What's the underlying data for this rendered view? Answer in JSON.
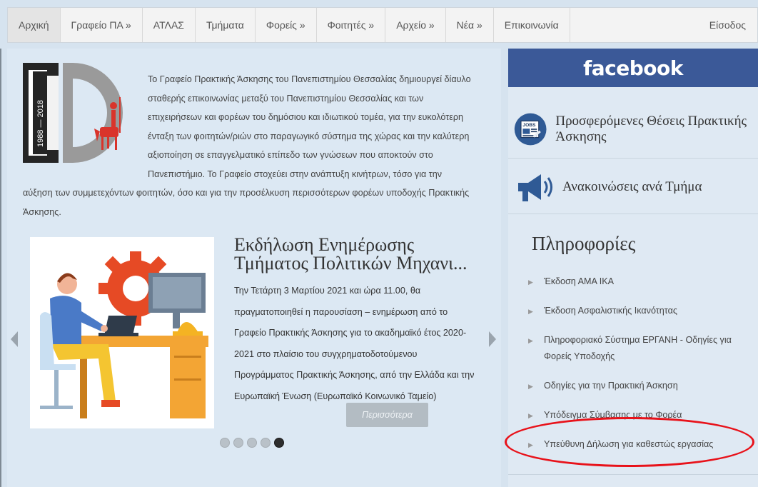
{
  "nav": {
    "items": [
      "Αρχική",
      "Γραφείο ΠΑ »",
      "ΑΤΛΑΣ",
      "Τμήματα",
      "Φορείς »",
      "Φοιτητές »",
      "Αρχείο »",
      "Νέα »",
      "Επικοινωνία"
    ],
    "login": "Είσοδος"
  },
  "logo": {
    "years": "1988 — 2018"
  },
  "intro": {
    "text": "Το Γραφείο Πρακτικής Άσκησης του Πανεπιστημίου Θεσσαλίας δημιουργεί δίαυλο σταθερής επικοινωνίας μεταξύ του Πανεπιστημίου Θεσσαλίας και των επιχειρήσεων και φορέων του δημόσιου και ιδιωτικού τομέα, για την ευκολότερη ένταξη των φοιτητών/ριών στο παραγωγικό σύστημα της χώρας και την καλύτερη αξιοποίηση σε επαγγελματικό επίπεδο των γνώσεων που αποκτούν στο Πανεπιστήμιο. Το Γραφείο στοχεύει στην ανάπτυξη κινήτρων, τόσο για την αύξηση των συμμετεχόντων φοιτητών, όσο και για την προσέλκυση περισσότερων φορέων υποδοχής Πρακτικής Άσκησης."
  },
  "slider": {
    "title": "Εκδήλωση Ενημέρωσης Τμήματος Πολιτικών Μηχανι...",
    "text": "Την Τετάρτη 3 Μαρτίου 2021 και ώρα 11.00, θα πραγματοποιηθεί η παρουσίαση – ενημέρωση από το Γραφείο Πρακτικής Άσκησης για το ακαδημαϊκό έτος 2020-2021 στο πλαίσιο του συγχρηματοδοτούμενου Προγράμματος Πρακτικής Άσκησης, από την Ελλάδα και την Ευρωπαϊκή Ένωση (Ευρωπαϊκό Κοινωνικό Ταμείο)",
    "more": "Περισσότερα",
    "dot_count": 5,
    "active_dot": 5
  },
  "sidebar": {
    "facebook": "facebook",
    "jobs_badge": "JOBS",
    "links": [
      {
        "label": "Προσφερόμενες Θέσεις Πρακτικής Άσκησης",
        "icon": "jobs-newspaper-icon"
      },
      {
        "label": "Ανακοινώσεις ανά Τμήμα",
        "icon": "megaphone-icon"
      }
    ],
    "info_title": "Πληροφορίες",
    "info_items": [
      "Έκδοση ΑΜΑ ΙΚΑ",
      "Έκδοση Ασφαλιστικής Ικανότητας",
      "Πληροφοριακό Σύστημα ΕΡΓΑΝΗ - Οδηγίες για Φορείς Υποδοχής",
      "Οδηγίες για την Πρακτική Άσκηση",
      "Υπόδειγμα Σύμβασης με το Φορέα",
      "Υπεύθυνη Δήλωση για καθεστώς εργασίας"
    ]
  },
  "colors": {
    "facebook": "#3b5998",
    "highlight": "#e8121a",
    "page_bg": "#d6e3ef"
  }
}
